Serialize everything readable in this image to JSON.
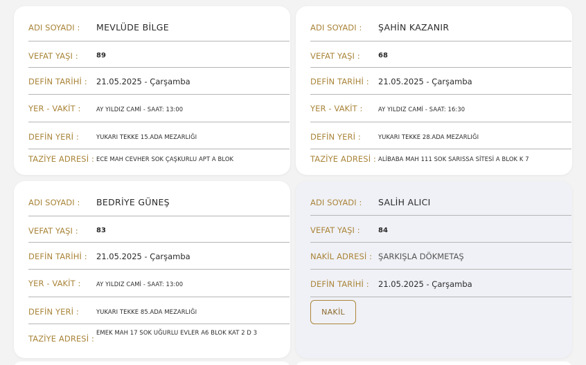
{
  "cards": [
    {
      "name_label": "ADI SOYADI :",
      "name": "MEVLÜDE BİLGE",
      "age_label": "VEFAT YAŞI :",
      "age": "89",
      "date_label": "DEFİN TARİHİ :",
      "date": "21.05.2025 - Çarşamba",
      "place_label": "YER - VAKİT :",
      "place": "AY YILDIZ CAMİ - SAAT: 13:00",
      "grave_label": "DEFİN YERİ :",
      "grave": "YUKARI TEKKE 15.ADA MEZARLIĞI",
      "address_label": "TAZİYE ADRESİ :",
      "address": "ECE MAH CEVHER SOK ÇAŞKURLU APT A BLOK"
    },
    {
      "name_label": "ADI SOYADI :",
      "name": "ŞAHİN KAZANIR",
      "age_label": "VEFAT YAŞI :",
      "age": "68",
      "date_label": "DEFİN TARİHİ :",
      "date": "21.05.2025 - Çarşamba",
      "place_label": "YER - VAKİT :",
      "place": "AY YILDIZ CAMİ - SAAT: 16:30",
      "grave_label": "DEFİN YERİ :",
      "grave": "YUKARI TEKKE 28.ADA MEZARLIĞI",
      "address_label": "TAZİYE ADRESİ :",
      "address": "ALİBABA MAH 111 SOK SARISSA SİTESİ A BLOK K 7"
    },
    {
      "name_label": "ADI SOYADI :",
      "name": "BEDRİYE GÜNEŞ",
      "age_label": "VEFAT YAŞI :",
      "age": "83",
      "date_label": "DEFİN TARİHİ :",
      "date": "21.05.2025 - Çarşamba",
      "place_label": "YER - VAKİT :",
      "place": "AY YILDIZ CAMİ - SAAT: 13:00",
      "grave_label": "DEFİN YERİ :",
      "grave": "YUKARI TEKKE 85.ADA MEZARLIĞI",
      "address_label": "TAZİYE ADRESİ :",
      "address": "EMEK MAH 17 SOK UĞURLU EVLER A6 BLOK KAT 2 D 3"
    }
  ],
  "nakil_card": {
    "name_label": "ADI SOYADI :",
    "name": "SALİH ALICI",
    "age_label": "VEFAT YAŞI :",
    "age": "84",
    "origin_label": "NAKİL ADRESİ :",
    "origin": "ŞARKIŞLA DÖKMETAŞ",
    "date_label": "DEFİN TARİHİ :",
    "date": "21.05.2025 - Çarşamba",
    "button_label": "NAKİL"
  },
  "colors": {
    "label": "#a98439",
    "value": "#2a2a2a",
    "divider": "#b5b5b5",
    "card": "#ffffff",
    "card_highlight": "#f0f1f6",
    "background": "#f3f3f3"
  }
}
